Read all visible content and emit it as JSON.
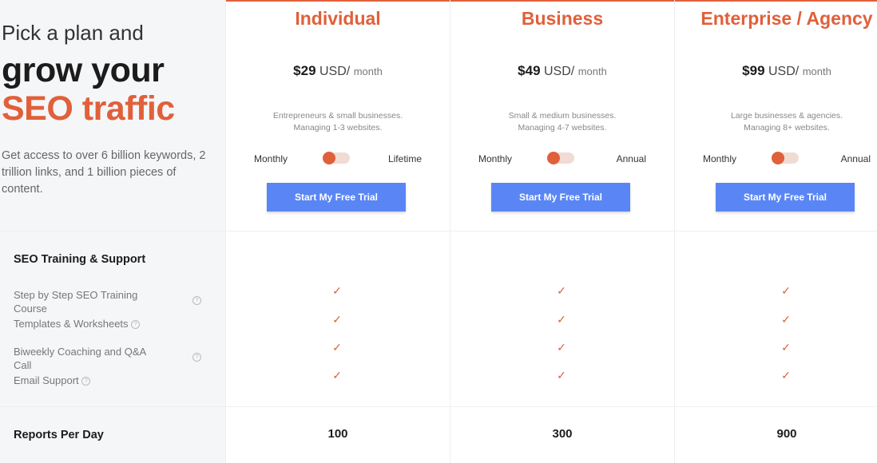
{
  "intro": {
    "line1": "Pick a plan and",
    "line2": "grow your",
    "line3": "SEO traffic",
    "text": "Get access to over 6 billion keywords, 2 trillion links, and 1 billion pieces of content."
  },
  "plans": [
    {
      "name": "Individual",
      "price": "$29",
      "currency": "USD/",
      "period": "month",
      "desc1": "Entrepreneurs & small businesses.",
      "desc2": "Managing 1-3 websites.",
      "toggle_left": "Monthly",
      "toggle_right": "Lifetime",
      "cta": "Start My Free Trial",
      "reports": "100"
    },
    {
      "name": "Business",
      "price": "$49",
      "currency": "USD/",
      "period": "month",
      "desc1": "Small & medium businesses.",
      "desc2": "Managing 4-7 websites.",
      "toggle_left": "Monthly",
      "toggle_right": "Annual",
      "cta": "Start My Free Trial",
      "reports": "300"
    },
    {
      "name": "Enterprise / Agency",
      "price": "$99",
      "currency": "USD/",
      "period": "month",
      "desc1": "Large businesses & agencies.",
      "desc2": "Managing 8+ websites.",
      "toggle_left": "Monthly",
      "toggle_right": "Annual",
      "cta": "Start My Free Trial",
      "reports": "900"
    }
  ],
  "section_training": {
    "title": "SEO Training & Support",
    "features": [
      "Step by Step SEO Training Course",
      "Templates & Worksheets",
      "Biweekly Coaching and Q&A Call",
      "Email Support"
    ],
    "info_icon": "help-circle-icon",
    "check_icon": "checkmark-icon"
  },
  "section_reports": {
    "title": "Reports Per Day"
  },
  "colors": {
    "accent": "#e0603a",
    "button": "#5a86f5",
    "panel": "#f5f6f8"
  }
}
